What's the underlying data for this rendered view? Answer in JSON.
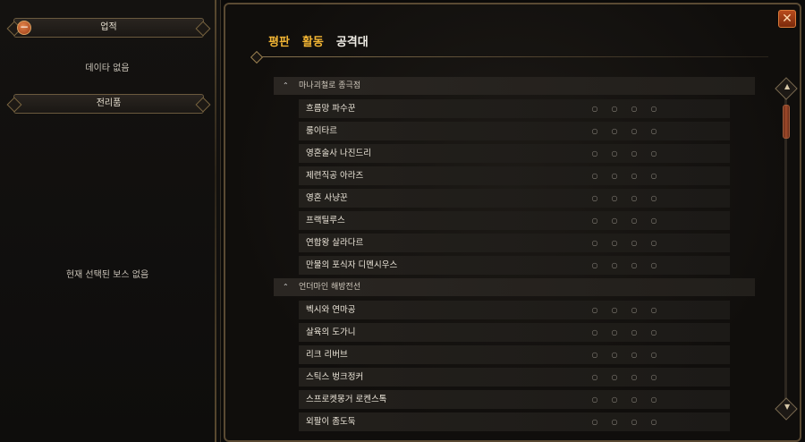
{
  "left": {
    "achievements_header": "업적",
    "no_data": "데이타 없음",
    "trophy_header": "전리품",
    "no_boss_selected": "현재 선택된 보스 없음"
  },
  "tabs": [
    {
      "label": "평판",
      "active": true
    },
    {
      "label": "활동",
      "active": true
    },
    {
      "label": "공격대",
      "active": false
    }
  ],
  "groups": [
    {
      "name": "마나괴철로 종극점",
      "bosses": [
        "흐름망 파수꾼",
        "룸이타르",
        "영혼술사 나진드리",
        "제련직공 아라즈",
        "영혼 사냥꾼",
        "프랙틸루스",
        "연합왕 살라다르",
        "만물의 포식자 디멘시우스"
      ]
    },
    {
      "name": "언더마인 해방전선",
      "bosses": [
        "벡시와 연마공",
        "살육의 도가니",
        "리크 리버브",
        "스틱스 벙크정커",
        "스프로켓몽거 로켄스톡",
        "외팔이 좀도둑"
      ]
    }
  ],
  "difficulty_marks": [
    "○",
    "○",
    "○",
    "○"
  ],
  "colors": {
    "active_tab": "#f2b534",
    "accent": "#b84a1c"
  },
  "icons": {
    "close": "close-icon",
    "collapse": "minus-icon",
    "expand": "caret-up-icon"
  }
}
